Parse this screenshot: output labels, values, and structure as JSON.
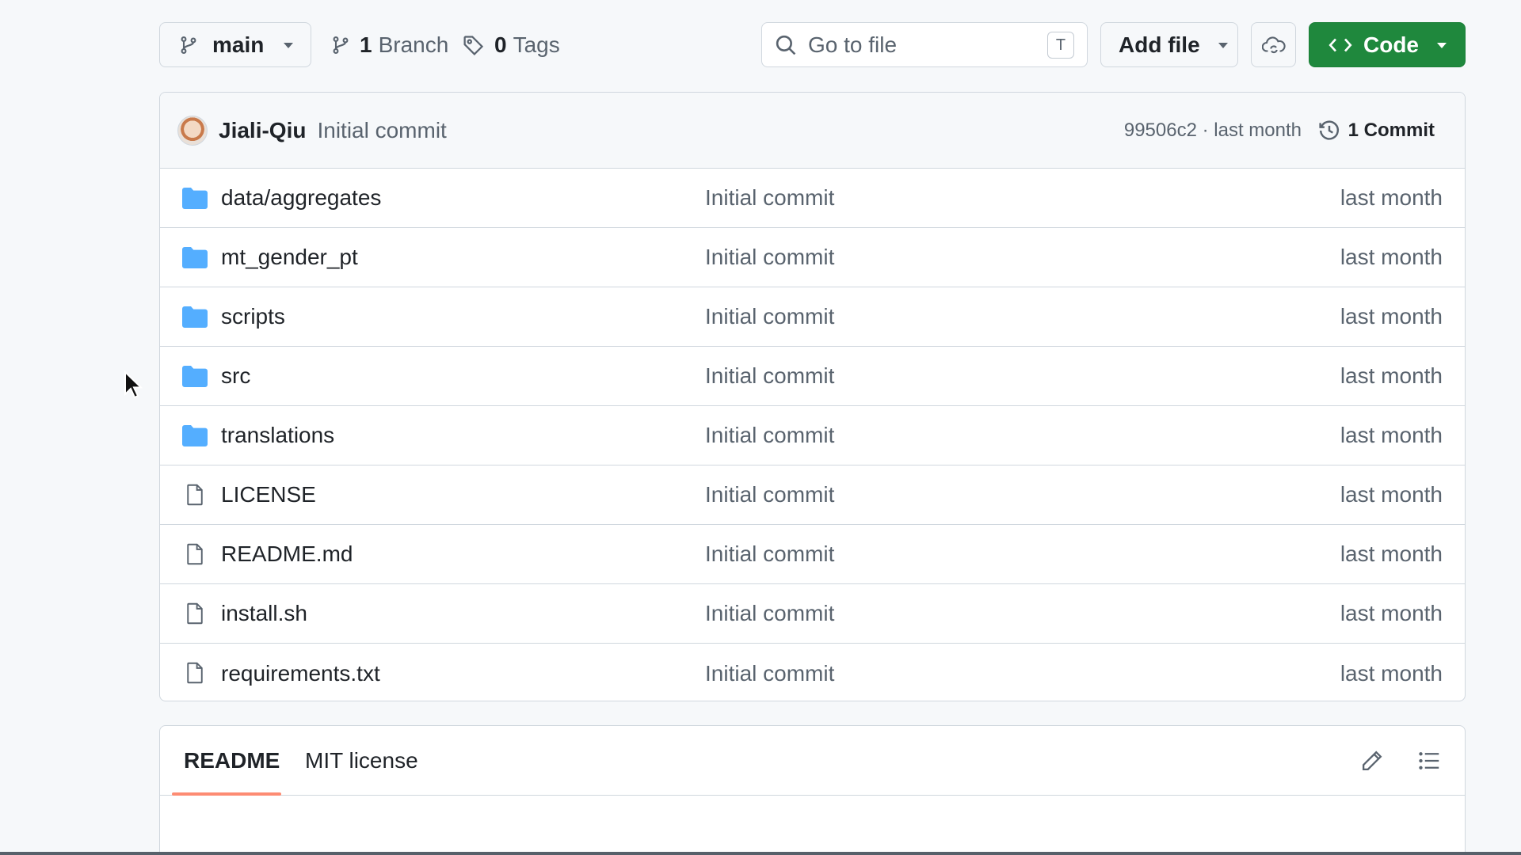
{
  "toolbar": {
    "branch": "main",
    "branch_count": "1",
    "branch_label": "Branch",
    "tag_count": "0",
    "tag_label": "Tags",
    "search_placeholder": "Go to file",
    "search_shortcut": "T",
    "add_file_label": "Add file",
    "code_label": "Code"
  },
  "latest_commit": {
    "author": "Jiali-Qiu",
    "message": "Initial commit",
    "meta": "99506c2 · last month",
    "commit_count_label": "1 Commit"
  },
  "files": [
    {
      "name": "data/aggregates",
      "type": "folder",
      "message": "Initial commit",
      "date": "last month"
    },
    {
      "name": "mt_gender_pt",
      "type": "folder",
      "message": "Initial commit",
      "date": "last month"
    },
    {
      "name": "scripts",
      "type": "folder",
      "message": "Initial commit",
      "date": "last month"
    },
    {
      "name": "src",
      "type": "folder",
      "message": "Initial commit",
      "date": "last month"
    },
    {
      "name": "translations",
      "type": "folder",
      "message": "Initial commit",
      "date": "last month"
    },
    {
      "name": "LICENSE",
      "type": "file",
      "message": "Initial commit",
      "date": "last month"
    },
    {
      "name": "README.md",
      "type": "file",
      "message": "Initial commit",
      "date": "last month"
    },
    {
      "name": "install.sh",
      "type": "file",
      "message": "Initial commit",
      "date": "last month"
    },
    {
      "name": "requirements.txt",
      "type": "file",
      "message": "Initial commit",
      "date": "last month"
    }
  ],
  "readme": {
    "tabs": [
      "README",
      "MIT license"
    ],
    "active_tab": "README"
  },
  "colors": {
    "accent_green": "#1f883d",
    "folder_blue": "#54aeff",
    "tab_underline": "#fd8c73"
  },
  "icons": {
    "branch": "git-branch-icon",
    "tag": "tag-icon",
    "search": "search-icon",
    "sync": "cloud-sync-icon",
    "code": "code-icon",
    "history": "history-icon",
    "folder": "folder-icon",
    "file": "file-icon",
    "edit": "pencil-icon",
    "outline": "list-icon"
  }
}
